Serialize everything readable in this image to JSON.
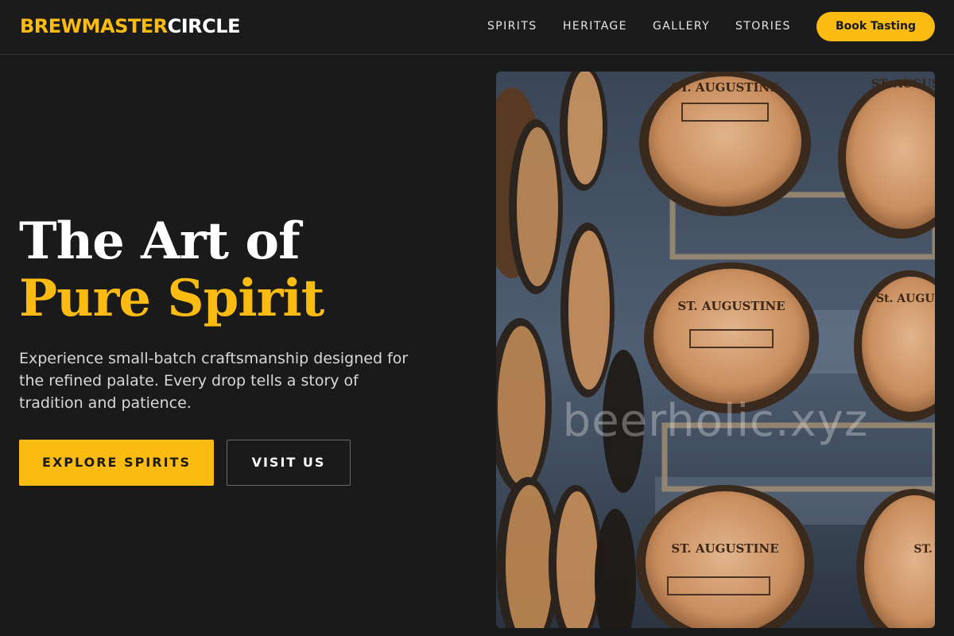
{
  "brand": {
    "part1": "BREWMASTER",
    "part2": "CIRCLE"
  },
  "nav": {
    "items": [
      {
        "label": "SPIRITS"
      },
      {
        "label": "HERITAGE"
      },
      {
        "label": "GALLERY"
      },
      {
        "label": "STORIES"
      }
    ],
    "cta_label": "Book Tasting"
  },
  "hero": {
    "title_line1": "The Art of",
    "title_line2": "Pure Spirit",
    "description": "Experience small-batch craftsmanship designed for the refined palate. Every drop tells a story of tradition and patience.",
    "primary_button": "EXPLORE SPIRITS",
    "secondary_button": "VISIT US",
    "image_watermark": "beerholic.xyz"
  },
  "colors": {
    "accent": "#fbbb10",
    "background": "#1a1a1a",
    "text_primary": "#ffffff",
    "text_secondary": "#d8d8d8"
  }
}
